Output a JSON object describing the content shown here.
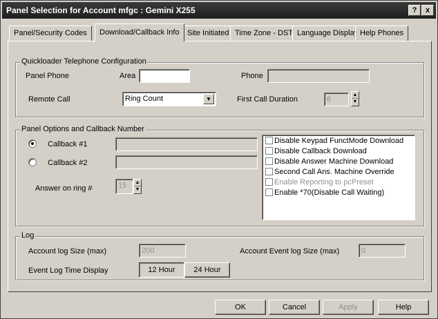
{
  "window": {
    "title": "Panel Selection for Account mfgc : Gemini X255",
    "help_label": "?",
    "close_label": "x"
  },
  "tabs": [
    {
      "label": "Panel/Security Codes"
    },
    {
      "label": "Download/Callback Info"
    },
    {
      "label": "Site Initiated"
    },
    {
      "label": "Time Zone - DST"
    },
    {
      "label": "Language Display"
    },
    {
      "label": "Help Phones"
    }
  ],
  "quickloader": {
    "legend": "Quickloader Telephone Configuration",
    "panel_phone_label": "Panel Phone",
    "area_label": "Area",
    "area_value": "",
    "phone_label": "Phone",
    "phone_value": "",
    "remote_call_label": "Remote Call",
    "remote_call_value": "Ring Count",
    "first_call_duration_label": "First Call Duration",
    "first_call_duration_value": "6"
  },
  "panel_options": {
    "legend": "Panel Options and Callback Number",
    "callback1_label": "Callback #1",
    "callback1_value": "",
    "callback2_label": "Callback #2",
    "callback2_value": "",
    "answer_ring_label": "Answer on ring #",
    "answer_ring_value": "15",
    "options": [
      {
        "label": "Disable Keypad FunctMode Download",
        "checked": false,
        "enabled": true
      },
      {
        "label": "Disable Callback Download",
        "checked": false,
        "enabled": true
      },
      {
        "label": "Disable Answer Machine Download",
        "checked": false,
        "enabled": true
      },
      {
        "label": "Second Call Ans. Machine Override",
        "checked": false,
        "enabled": true
      },
      {
        "label": "Enable Reporting to pcPreset",
        "checked": false,
        "enabled": false
      },
      {
        "label": "Enable *70(Disable Call Waiting)",
        "checked": false,
        "enabled": true
      }
    ]
  },
  "log": {
    "legend": "Log",
    "account_log_size_label": "Account log Size (max)",
    "account_log_size_value": "200",
    "account_event_log_size_label": "Account Event log Size (max)",
    "account_event_log_size_value": "0",
    "event_log_time_label": "Event Log Time Display",
    "hour12_label": "12 Hour",
    "hour24_label": "24 Hour"
  },
  "buttons": {
    "ok": "OK",
    "cancel": "Cancel",
    "apply": "Apply",
    "help": "Help"
  }
}
